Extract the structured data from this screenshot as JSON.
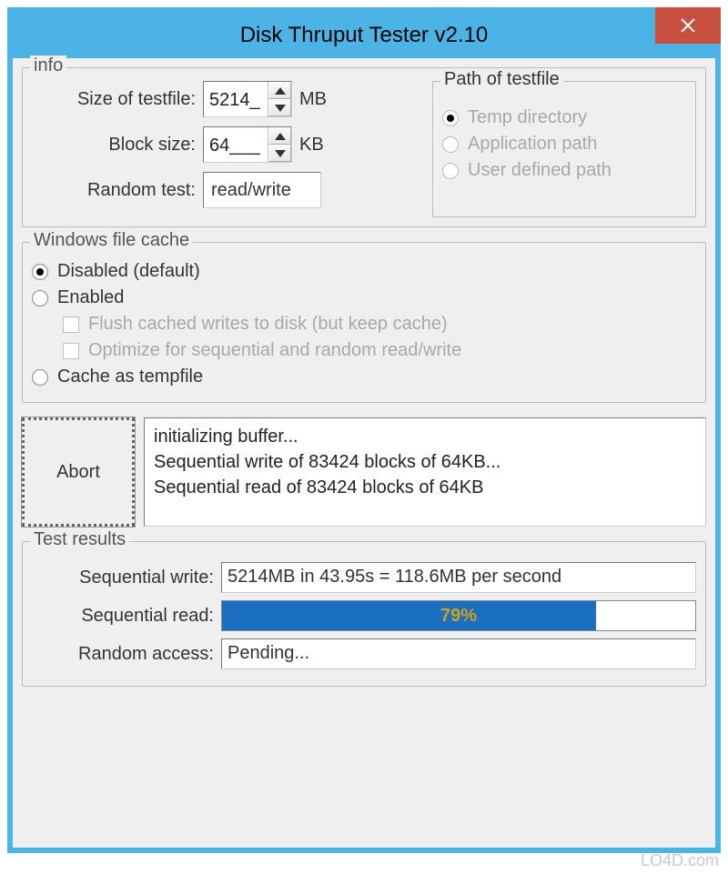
{
  "window": {
    "title": "Disk Thruput Tester v2.10"
  },
  "info": {
    "legend": "info",
    "size_label": "Size of testfile:",
    "size_value": "5214_",
    "size_unit": "MB",
    "block_label": "Block size:",
    "block_value": "64___",
    "block_unit": "KB",
    "random_label": "Random test:",
    "random_value": "read/write",
    "path": {
      "legend": "Path of testfile",
      "temp": "Temp directory",
      "app": "Application path",
      "user": "User defined path"
    }
  },
  "cache": {
    "legend": "Windows file cache",
    "disabled": "Disabled (default)",
    "enabled": "Enabled",
    "flush": "Flush cached writes to disk (but keep cache)",
    "optimize": "Optimize for sequential and random read/write",
    "tempfile": "Cache as tempfile"
  },
  "run": {
    "abort": "Abort",
    "log": {
      "l1": "initializing buffer...",
      "l2": "Sequential write of 83424 blocks of 64KB...",
      "l3": "Sequential read of 83424 blocks of 64KB"
    }
  },
  "results": {
    "legend": "Test results",
    "seq_write_label": "Sequential write:",
    "seq_write_value": "5214MB in 43.95s = 118.6MB per second",
    "seq_read_label": "Sequential read:",
    "seq_read_pct": "79%",
    "seq_read_progress": 79,
    "random_label": "Random access:",
    "random_value": "Pending..."
  },
  "watermark": "LO4D.com"
}
